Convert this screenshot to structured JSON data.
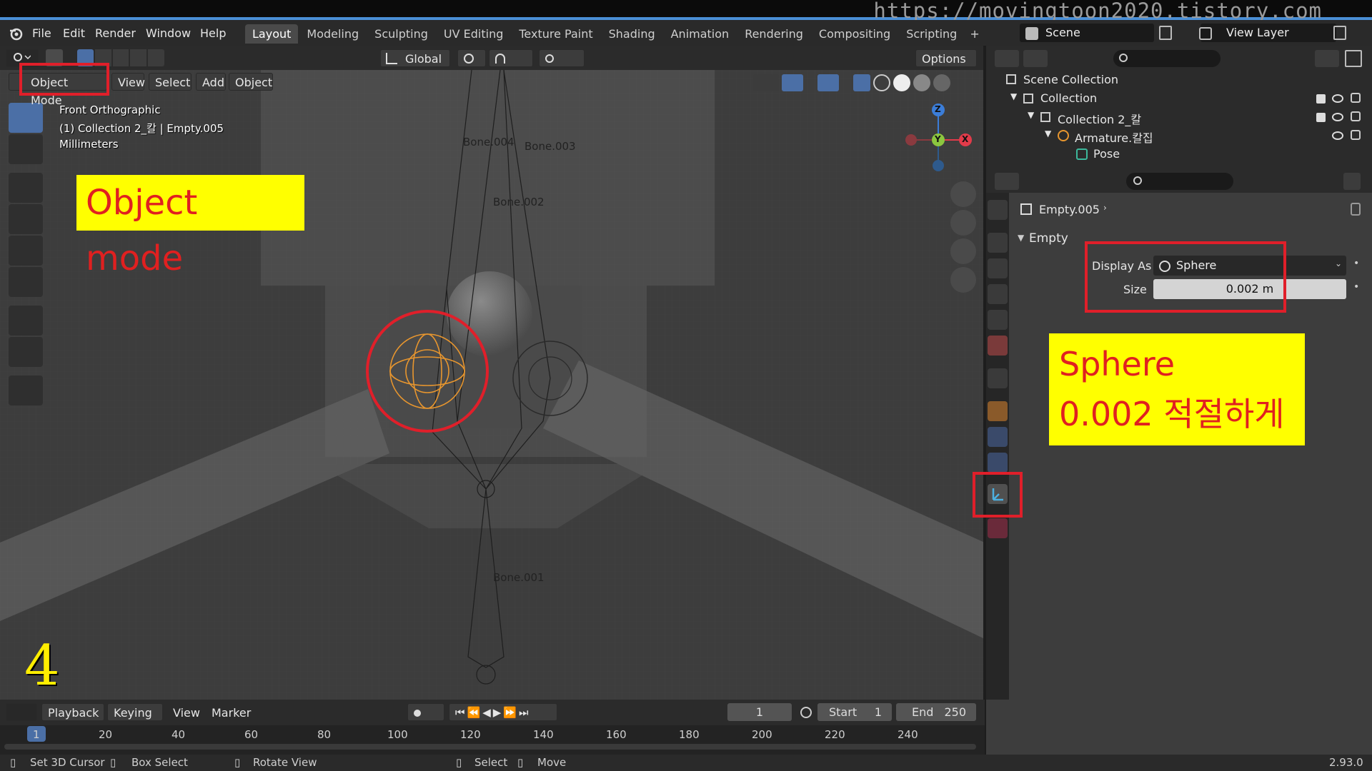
{
  "watermark_url": "https://movingtoon2020.tistory.com",
  "menu": [
    "File",
    "Edit",
    "Render",
    "Window",
    "Help"
  ],
  "workspaces": [
    "Layout",
    "Modeling",
    "Sculpting",
    "UV Editing",
    "Texture Paint",
    "Shading",
    "Animation",
    "Rendering",
    "Compositing",
    "Scripting"
  ],
  "workspace_add": "+",
  "scene": "Scene",
  "view_layer": "View Layer",
  "viewport_header": {
    "transform_orientation": "Global",
    "options": "Options"
  },
  "mode_bar": {
    "mode": "Object Mode",
    "items": [
      "View",
      "Select",
      "Add",
      "Object"
    ]
  },
  "overlay_info": {
    "view": "Front Orthographic",
    "collection": "(1) Collection 2_칼 | Empty.005",
    "units": "Millimeters"
  },
  "annotations": {
    "object_mode": "Object mode",
    "sphere_line1": "Sphere",
    "sphere_line2": "0.002 적절하게",
    "step": "4"
  },
  "bones": [
    "Bone.004",
    "Bone.003",
    "Bone.002",
    "Bone.001"
  ],
  "gizmo": {
    "z": "Z",
    "y": "Y",
    "x": "X"
  },
  "outliner": {
    "root": "Scene Collection",
    "items": [
      {
        "label": "Collection"
      },
      {
        "label": "Collection 2_칼"
      },
      {
        "label": "Armature.칼집"
      },
      {
        "label": "Pose"
      }
    ]
  },
  "properties": {
    "object": "Empty.005",
    "panel": "Empty",
    "display_as_label": "Display As",
    "display_as_value": "Sphere",
    "size_label": "Size",
    "size_value": "0.002 m"
  },
  "timeline": {
    "items": [
      "Playback",
      "Keying",
      "View",
      "Marker"
    ],
    "current_frame": "1",
    "start_label": "Start",
    "start_value": "1",
    "end_label": "End",
    "end_value": "250",
    "ruler": [
      "1",
      "20",
      "40",
      "60",
      "80",
      "100",
      "120",
      "140",
      "160",
      "180",
      "200",
      "220",
      "240"
    ]
  },
  "statusbar": {
    "set_cursor": "Set 3D Cursor",
    "box_select": "Box Select",
    "rotate_view": "Rotate View",
    "select": "Select",
    "move": "Move",
    "version": "2.93.0"
  },
  "colors": {
    "accent_red": "#e01f2a",
    "annotation_yellow": "#ffff00",
    "selection_orange": "#e8962e",
    "active_blue": "#4b6fa6"
  }
}
